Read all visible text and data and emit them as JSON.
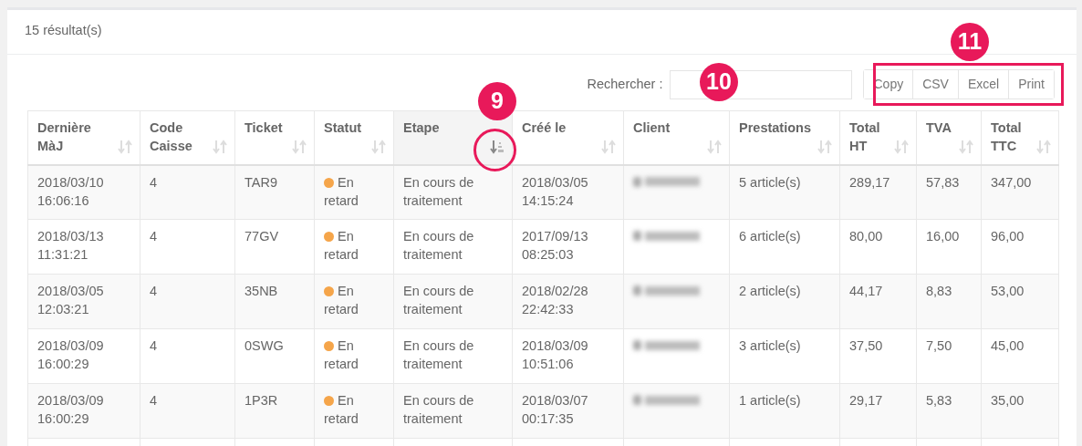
{
  "results_title": "15 résultat(s)",
  "search": {
    "label": "Rechercher :"
  },
  "export_buttons": [
    "Copy",
    "CSV",
    "Excel",
    "Print"
  ],
  "table": {
    "columns": [
      {
        "label": "Dernière MàJ",
        "sorted": false
      },
      {
        "label": "Code Caisse",
        "sorted": false
      },
      {
        "label": "Ticket",
        "sorted": false
      },
      {
        "label": "Statut",
        "sorted": false
      },
      {
        "label": "Etape",
        "sorted": true
      },
      {
        "label": "Créé le",
        "sorted": false
      },
      {
        "label": "Client",
        "sorted": false
      },
      {
        "label": "Prestations",
        "sorted": false
      },
      {
        "label": "Total HT",
        "sorted": false
      },
      {
        "label": "TVA",
        "sorted": false
      },
      {
        "label": "Total TTC",
        "sorted": false
      }
    ],
    "rows": [
      {
        "updated": "2018/03/10 16:06:16",
        "register": "4",
        "ticket": "TAR9",
        "status": "En retard",
        "color": "#f5a54a",
        "step": "En cours de traitement",
        "created": "2018/03/05 14:15:24",
        "items": "5 article(s)",
        "total_ht": "289,17",
        "tva": "57,83",
        "total_ttc": "347,00"
      },
      {
        "updated": "2018/03/13 11:31:21",
        "register": "4",
        "ticket": "77GV",
        "status": "En retard",
        "color": "#f5a54a",
        "step": "En cours de traitement",
        "created": "2017/09/13 08:25:03",
        "items": "6 article(s)",
        "total_ht": "80,00",
        "tva": "16,00",
        "total_ttc": "96,00"
      },
      {
        "updated": "2018/03/05 12:03:21",
        "register": "4",
        "ticket": "35NB",
        "status": "En retard",
        "color": "#f5a54a",
        "step": "En cours de traitement",
        "created": "2018/02/28 22:42:33",
        "items": "2 article(s)",
        "total_ht": "44,17",
        "tva": "8,83",
        "total_ttc": "53,00"
      },
      {
        "updated": "2018/03/09 16:00:29",
        "register": "4",
        "ticket": "0SWG",
        "status": "En retard",
        "color": "#f5a54a",
        "step": "En cours de traitement",
        "created": "2018/03/09 10:51:06",
        "items": "3 article(s)",
        "total_ht": "37,50",
        "tva": "7,50",
        "total_ttc": "45,00"
      },
      {
        "updated": "2018/03/09 16:00:29",
        "register": "4",
        "ticket": "1P3R",
        "status": "En retard",
        "color": "#f5a54a",
        "step": "En cours de traitement",
        "created": "2018/03/07 00:17:35",
        "items": "1 article(s)",
        "total_ht": "29,17",
        "tva": "5,83",
        "total_ttc": "35,00"
      }
    ]
  },
  "callouts": [
    "9",
    "10",
    "11"
  ]
}
